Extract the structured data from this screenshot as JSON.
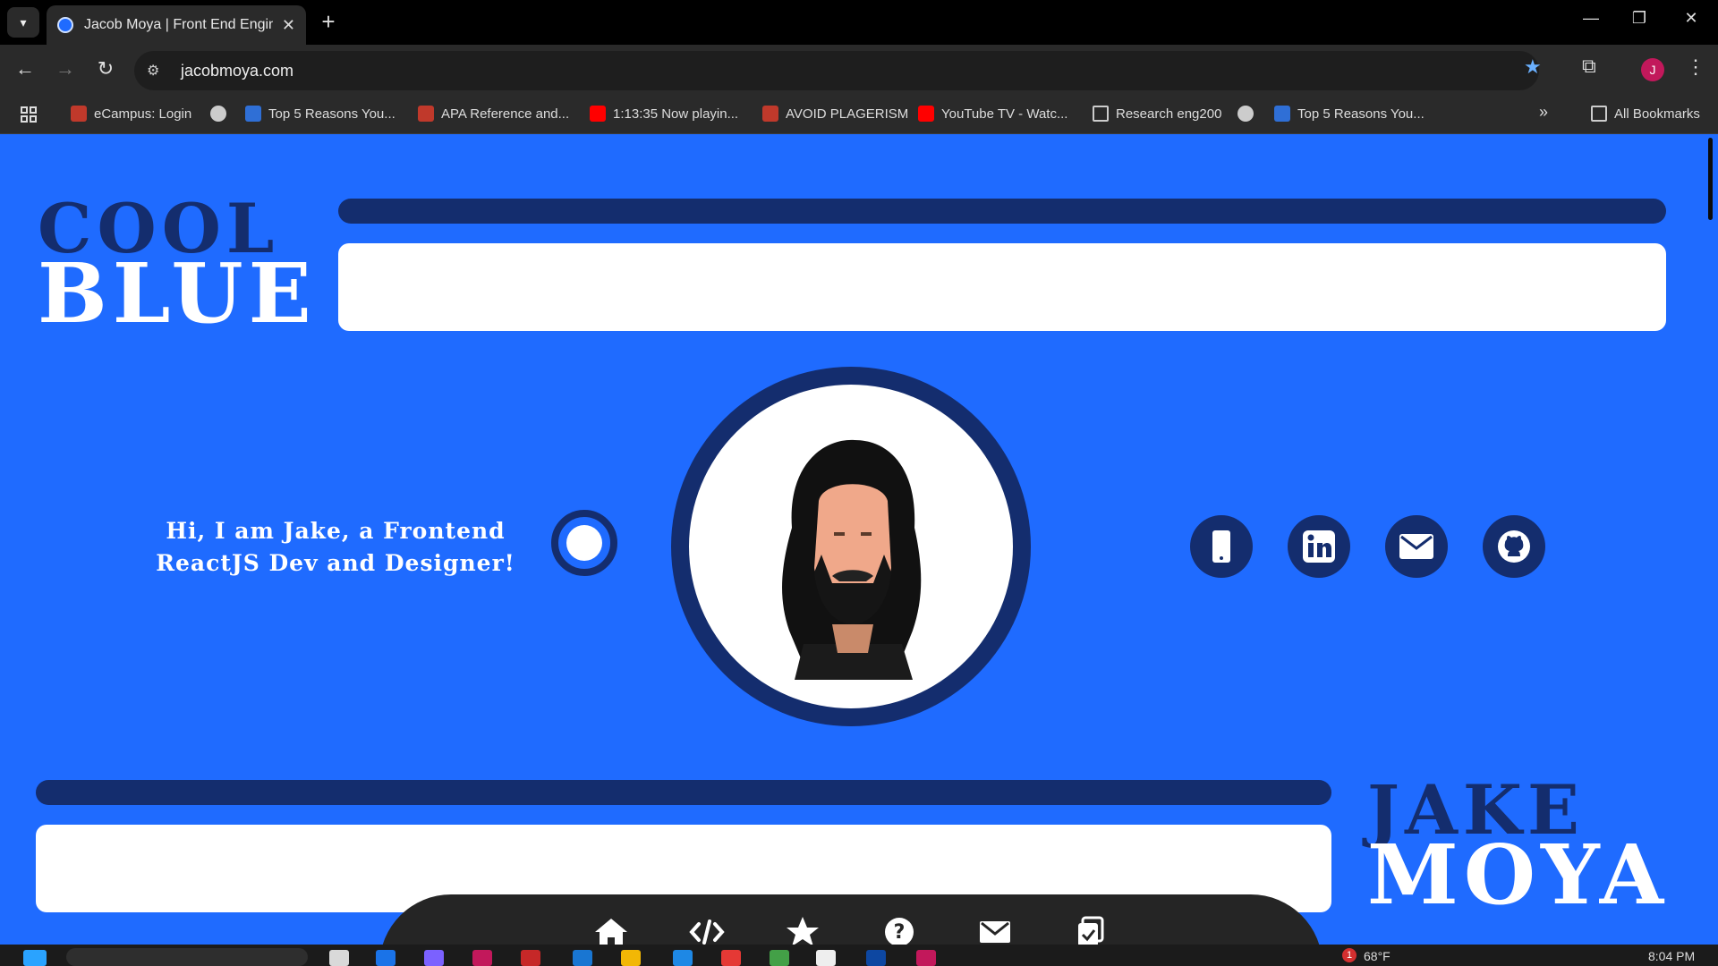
{
  "browser": {
    "tab_title": "Jacob Moya | Front End Engineer",
    "tab_close": "✕",
    "new_tab": "+",
    "url": "jacobmoya.com",
    "profile_initial": "J",
    "bookmarks": [
      {
        "label": "eCampus: Login",
        "icon": "ecampus-icon",
        "color": "#c0392b"
      },
      {
        "label": "",
        "icon": "globe-icon",
        "color": "#cccccc"
      },
      {
        "label": "Top 5 Reasons You...",
        "icon": "d-icon",
        "color": "#2f6fd6"
      },
      {
        "label": "APA Reference and...",
        "icon": "apa-icon",
        "color": "#c0392b"
      },
      {
        "label": "1:13:35 Now playin...",
        "icon": "youtube-icon",
        "color": "#ff0000"
      },
      {
        "label": "AVOID PLAGERISM",
        "icon": "plagiarism-icon",
        "color": "#c0392b"
      },
      {
        "label": "YouTube TV - Watc...",
        "icon": "youtube-icon",
        "color": "#ff0000"
      },
      {
        "label": "Research eng200",
        "icon": "folder-icon",
        "color": "#cccccc"
      },
      {
        "label": "",
        "icon": "cat-icon",
        "color": "#cccccc"
      },
      {
        "label": "Top 5 Reasons You...",
        "icon": "d-icon",
        "color": "#2f6fd6"
      }
    ],
    "more_bookmarks": "»",
    "all_bookmarks": "All Bookmarks"
  },
  "page": {
    "logo_top": {
      "line1": "COOL",
      "line2": "BLUE"
    },
    "logo_bottom": {
      "line1": "JAKE",
      "line2": "MOYA"
    },
    "intro": "Hi, I am Jake, a Frontend ReactJS Dev and Designer!",
    "social": [
      "phone-icon",
      "linkedin-icon",
      "email-icon",
      "github-icon"
    ],
    "bottom_nav": [
      "home-icon",
      "code-icon",
      "star-icon",
      "question-icon",
      "mail-icon",
      "clipboard-check-icon"
    ]
  },
  "taskbar": {
    "weather_badge": "1",
    "temperature": "68°F",
    "time": "8:04 PM"
  },
  "colors": {
    "background": "#1f6bff",
    "navy": "#142d6e",
    "white": "#ffffff",
    "chrome_dark": "#2a2a2a"
  }
}
